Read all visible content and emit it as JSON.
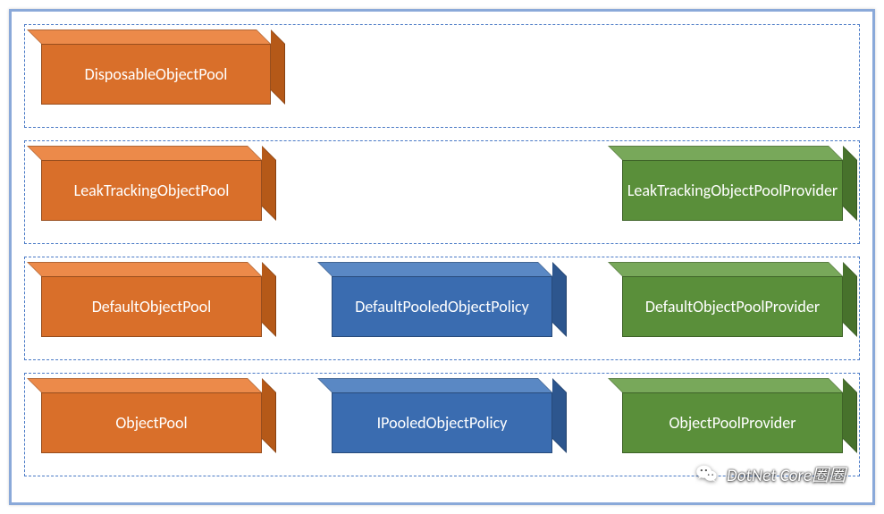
{
  "rows": [
    {
      "boxes": [
        {
          "label": "DisposableObjectPool",
          "color": "orange"
        },
        null,
        null
      ]
    },
    {
      "boxes": [
        {
          "label": "LeakTrackingObjectPool",
          "color": "orange"
        },
        null,
        {
          "label": "LeakTrackingObjectPoolProvider",
          "color": "green"
        }
      ]
    },
    {
      "boxes": [
        {
          "label": "DefaultObjectPool",
          "color": "orange"
        },
        {
          "label": "DefaultPooledObjectPolicy",
          "color": "blue"
        },
        {
          "label": "DefaultObjectPoolProvider",
          "color": "green"
        }
      ]
    },
    {
      "boxes": [
        {
          "label": "ObjectPool",
          "color": "orange"
        },
        {
          "label": "IPooledObjectPolicy",
          "color": "blue"
        },
        {
          "label": "ObjectPoolProvider",
          "color": "green"
        }
      ]
    }
  ],
  "watermark": {
    "text": "DotNet Core圈圈"
  },
  "colors": {
    "orange": "#d96f2a",
    "blue": "#3a6cb0",
    "green": "#5a8f3a"
  }
}
